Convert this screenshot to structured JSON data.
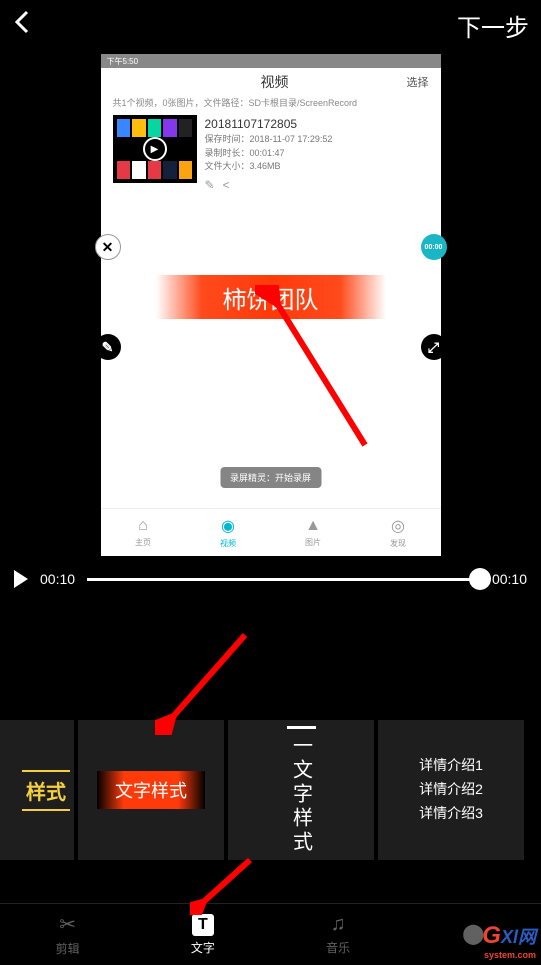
{
  "top": {
    "next": "下一步"
  },
  "preview": {
    "status_time": "下午5:50",
    "header_title": "视频",
    "header_select": "选择",
    "info": "共1个视频，0张图片，文件路径：SD卡根目录/ScreenRecord",
    "video_name": "20181107172805",
    "save_time": "保存时间：2018-11-07 17:29:52",
    "duration": "录制时长：00:01:47",
    "file_size": "文件大小：3.46MB",
    "overlay_text": "柿饼团队",
    "toast": "录屏精灵：开始录屏",
    "tabs": {
      "home": "主页",
      "video": "视频",
      "image": "图片",
      "discover": "发现"
    },
    "tr_badge": "00:00"
  },
  "timeline": {
    "current": "00:10",
    "total": "00:10"
  },
  "styles": {
    "yellow": "样式",
    "red": "文字样式",
    "vertical": "一文字样式",
    "details": [
      "详情介绍1",
      "详情介绍2",
      "详情介绍3"
    ]
  },
  "nav": {
    "edit": "剪辑",
    "text": "文字",
    "music": "音乐",
    "more": ""
  },
  "watermark": {
    "brand": "Gxl",
    "sub": "system.com"
  }
}
